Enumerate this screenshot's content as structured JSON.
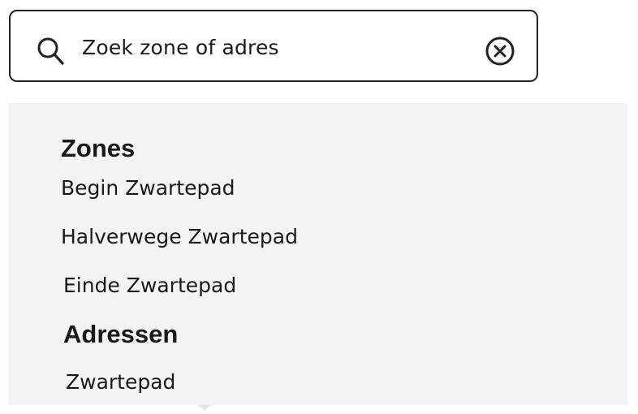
{
  "search": {
    "value": "Zoek zone of adres"
  },
  "icons": {
    "search": "search-icon",
    "clear": "clear-circle-x-icon"
  },
  "results": {
    "zones_heading": "Zones",
    "zones": [
      "Begin Zwartepad",
      "Halverwege Zwartepad",
      "Einde Zwartepad"
    ],
    "addresses_heading": "Adressen",
    "addresses": [
      "Zwartepad"
    ]
  },
  "colors": {
    "border": "#222222",
    "dropdown_background": "#f3f3f3",
    "text": "#1a1a1a"
  }
}
